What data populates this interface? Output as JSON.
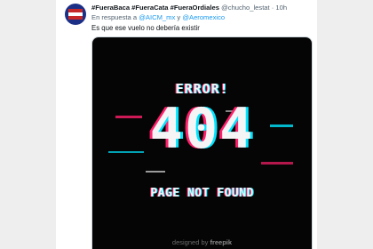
{
  "tweet": {
    "author_name": "#FueraBaca #FueraCata #FueraOrdiales",
    "author_handle": "@chucho_lestat",
    "separator": "·",
    "time": "10h",
    "reply_prefix": "En respuesta a",
    "reply_mention_1": "@AICM_mx",
    "reply_join": "y",
    "reply_mention_2": "@Aeromexico",
    "text": "Es que ese vuelo no debería existir"
  },
  "image": {
    "error_title": "ERROR!",
    "code": "404",
    "message": "PAGE NOT FOUND",
    "watermark_prefix": "designed by",
    "watermark_brand": "freepik"
  },
  "colors": {
    "accent": "#1d9bf0",
    "glitch_cyan": "#00e5ff",
    "glitch_magenta": "#ff1f6b",
    "image_bg": "#050505"
  }
}
